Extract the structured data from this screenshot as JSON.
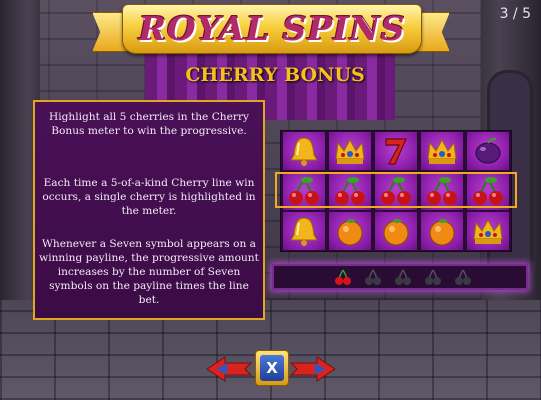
{
  "header": {
    "logo_text": "ROYAL SPINS",
    "page_indicator": "3 / 5"
  },
  "section": {
    "title": "CHERRY BONUS"
  },
  "info_panel": {
    "paragraph_1": "Highlight all 5 cherries in the Cherry Bonus meter to win the progressive.",
    "paragraph_2": "Each time a 5-of-a-kind Cherry line win occurs, a single cherry is highlighted in the meter.",
    "paragraph_3": "Whenever a Seven symbol appears on a winning payline, the progressive amount increases by the number of Seven symbols on the payline times the line bet."
  },
  "reels": {
    "rows": [
      [
        "bell-icon",
        "crown-icon",
        "seven-icon",
        "crown-icon",
        "plum-icon"
      ],
      [
        "cherry-icon",
        "cherry-icon",
        "cherry-icon",
        "cherry-icon",
        "cherry-icon"
      ],
      [
        "bell-icon",
        "orange-icon",
        "orange-icon",
        "orange-icon",
        "crown-icon"
      ]
    ],
    "highlighted_row": 2
  },
  "cherry_meter": {
    "total": 5,
    "highlighted": 1
  },
  "nav": {
    "close_label": "X",
    "prev_icon": "arrow-left-icon",
    "next_icon": "arrow-right-icon"
  },
  "colors": {
    "gold": "#f5c21a",
    "panel_purple": "#4a1057",
    "reel_purple": "#8a1ca8",
    "logo_pink": "#b32a6a"
  }
}
